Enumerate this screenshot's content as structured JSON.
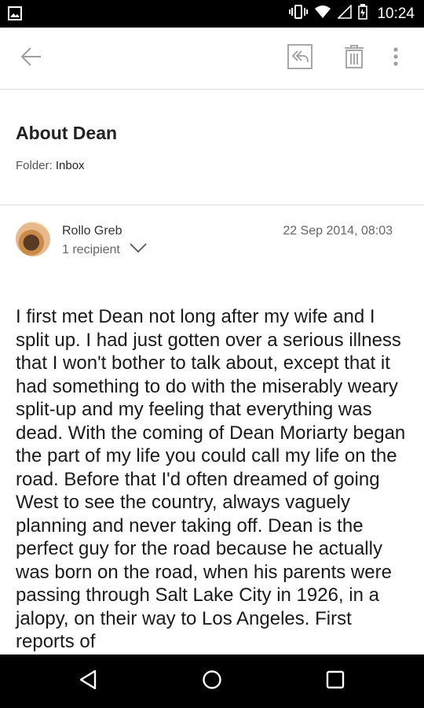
{
  "status_bar": {
    "time": "10:24",
    "icons": [
      "photo-icon",
      "vibrate-icon",
      "wifi-icon",
      "signal-icon",
      "battery-icon"
    ]
  },
  "toolbar": {
    "icons": [
      "back-arrow-icon",
      "reply-all-icon",
      "trash-icon",
      "more-vert-icon"
    ]
  },
  "message": {
    "subject": "About Dean",
    "folder_label": "Folder:",
    "folder_value": "Inbox",
    "sender": "Rollo Greb",
    "recipients": "1 recipient",
    "date": "22 Sep 2014, 08:03",
    "body": "I first met Dean not long after my wife and I split up. I had just gotten over a serious illness that I won't bother to talk about, except that it had something to do with the miserably weary split-up and my feeling that everything was dead. With the coming of Dean Moriarty began the part of my life you could call my life on the road. Before that I'd often dreamed of going West to see the country, always vaguely planning and never taking off. Dean is the perfect guy for the road because he actually was born on the road, when his parents were passing through Salt Lake City in 1926, in a jalopy, on their way to Los Angeles. First reports of"
  },
  "nav_bar": {
    "icons": [
      "nav-back-icon",
      "nav-home-icon",
      "nav-recents-icon"
    ]
  },
  "colors": {
    "status_bar_bg": "#000000",
    "icon_gray": "#9e9e9e",
    "divider": "#e0e0e0",
    "text_primary": "#222222"
  }
}
